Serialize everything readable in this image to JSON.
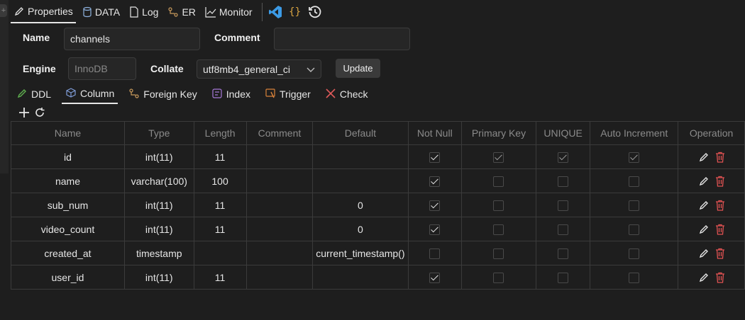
{
  "top_tabs": [
    {
      "label": "Properties",
      "icon": "pencil-icon",
      "active": true
    },
    {
      "label": "DATA",
      "icon": "database-icon"
    },
    {
      "label": "Log",
      "icon": "document-icon"
    },
    {
      "label": "ER",
      "icon": "er-diagram-icon"
    },
    {
      "label": "Monitor",
      "icon": "chart-line-icon"
    }
  ],
  "toolbar_icons": [
    "vscode-icon",
    "curly-braces-icon",
    "history-icon"
  ],
  "curly_text": "{}",
  "form": {
    "name_label": "Name",
    "name_value": "channels",
    "comment_label": "Comment",
    "comment_value": "",
    "engine_label": "Engine",
    "engine_placeholder": "InnoDB",
    "collate_label": "Collate",
    "collate_value": "utf8mb4_general_ci",
    "update_label": "Update"
  },
  "sub_tabs": [
    {
      "label": "DDL",
      "icon": "pencil-icon",
      "color": "#5fb04f"
    },
    {
      "label": "Column",
      "icon": "cube-icon",
      "color": "#7e9bd6",
      "active": true
    },
    {
      "label": "Foreign Key",
      "icon": "link-icon",
      "color": "#c99a5c"
    },
    {
      "label": "Index",
      "icon": "index-icon",
      "color": "#a678d8"
    },
    {
      "label": "Trigger",
      "icon": "trigger-icon",
      "color": "#d9823a"
    },
    {
      "label": "Check",
      "icon": "tools-icon",
      "color": "#e05a5a"
    }
  ],
  "columns_header": [
    "Name",
    "Type",
    "Length",
    "Comment",
    "Default",
    "Not Null",
    "Primary Key",
    "UNIQUE",
    "Auto Increment",
    "Operation"
  ],
  "rows": [
    {
      "name": "id",
      "type": "int(11)",
      "length": "11",
      "comment": "",
      "default": "",
      "not_null": true,
      "primary_key": true,
      "unique": true,
      "auto_increment": true
    },
    {
      "name": "name",
      "type": "varchar(100)",
      "length": "100",
      "comment": "",
      "default": "",
      "not_null": true,
      "primary_key": false,
      "unique": false,
      "auto_increment": false
    },
    {
      "name": "sub_num",
      "type": "int(11)",
      "length": "11",
      "comment": "",
      "default": "0",
      "not_null": true,
      "primary_key": false,
      "unique": false,
      "auto_increment": false
    },
    {
      "name": "video_count",
      "type": "int(11)",
      "length": "11",
      "comment": "",
      "default": "0",
      "not_null": true,
      "primary_key": false,
      "unique": false,
      "auto_increment": false
    },
    {
      "name": "created_at",
      "type": "timestamp",
      "length": "",
      "comment": "",
      "default": "current_timestamp()",
      "not_null": false,
      "primary_key": false,
      "unique": false,
      "auto_increment": false
    },
    {
      "name": "user_id",
      "type": "int(11)",
      "length": "11",
      "comment": "",
      "default": "",
      "not_null": true,
      "primary_key": false,
      "unique": false,
      "auto_increment": false
    }
  ],
  "colors": {
    "background": "#1e1e1e",
    "delete": "#e05252",
    "vscode": "#3c9be6",
    "curly": "#d9a441"
  }
}
